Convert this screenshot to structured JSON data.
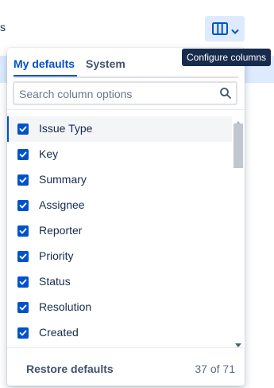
{
  "topbar": {
    "partial_text": "s"
  },
  "tooltip": "Configure columns",
  "tabs": [
    {
      "label": "My defaults",
      "active": true
    },
    {
      "label": "System",
      "active": false
    }
  ],
  "search": {
    "placeholder": "Search column options",
    "value": ""
  },
  "columns": [
    {
      "label": "Issue Type",
      "checked": true,
      "highlighted": true
    },
    {
      "label": "Key",
      "checked": true
    },
    {
      "label": "Summary",
      "checked": true
    },
    {
      "label": "Assignee",
      "checked": true
    },
    {
      "label": "Reporter",
      "checked": true
    },
    {
      "label": "Priority",
      "checked": true
    },
    {
      "label": "Status",
      "checked": true
    },
    {
      "label": "Resolution",
      "checked": true
    },
    {
      "label": "Created",
      "checked": true
    }
  ],
  "footer": {
    "restore_label": "Restore defaults",
    "count": "37 of 71"
  },
  "colors": {
    "accent": "#0052cc",
    "tooltip_bg": "#172b4d",
    "button_bg": "#deebff"
  }
}
